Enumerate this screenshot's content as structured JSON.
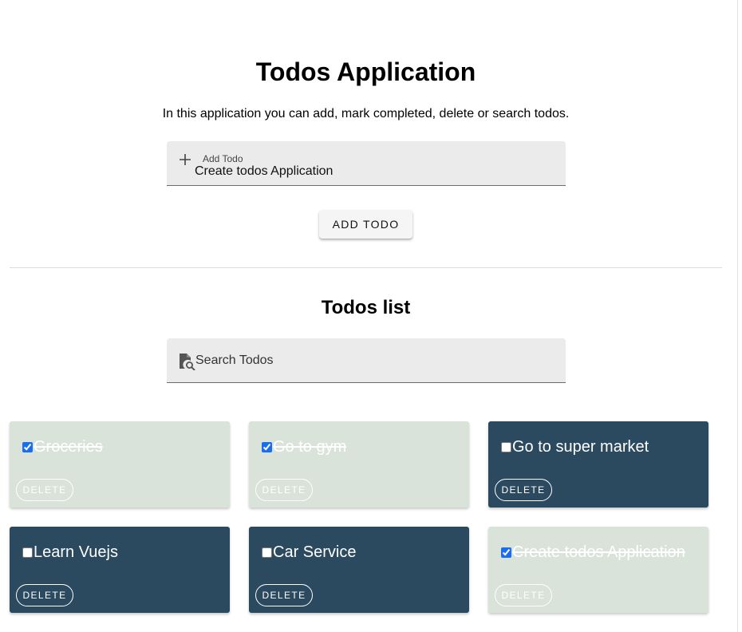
{
  "header": {
    "title": "Todos Application",
    "subtitle": "In this application you can add, mark completed, delete or search todos."
  },
  "add_todo": {
    "label": "Add Todo",
    "value": "Create todos Application",
    "button_label": "ADD TODO",
    "icon": "plus-icon"
  },
  "list": {
    "title": "Todos list",
    "search_placeholder": "Search Todos",
    "search_icon": "file-search-icon",
    "delete_label": "DELETE",
    "items": [
      {
        "text": "Groceries",
        "completed": true
      },
      {
        "text": "Go to gym",
        "completed": true
      },
      {
        "text": "Go to super market",
        "completed": false
      },
      {
        "text": "Learn Vuejs",
        "completed": false
      },
      {
        "text": "Car Service",
        "completed": false
      },
      {
        "text": "Create todos Application",
        "completed": true
      }
    ]
  },
  "colors": {
    "completed_card": "#d9e3d9",
    "pending_card": "#2c4a5f",
    "field_background": "#ebebeb"
  }
}
